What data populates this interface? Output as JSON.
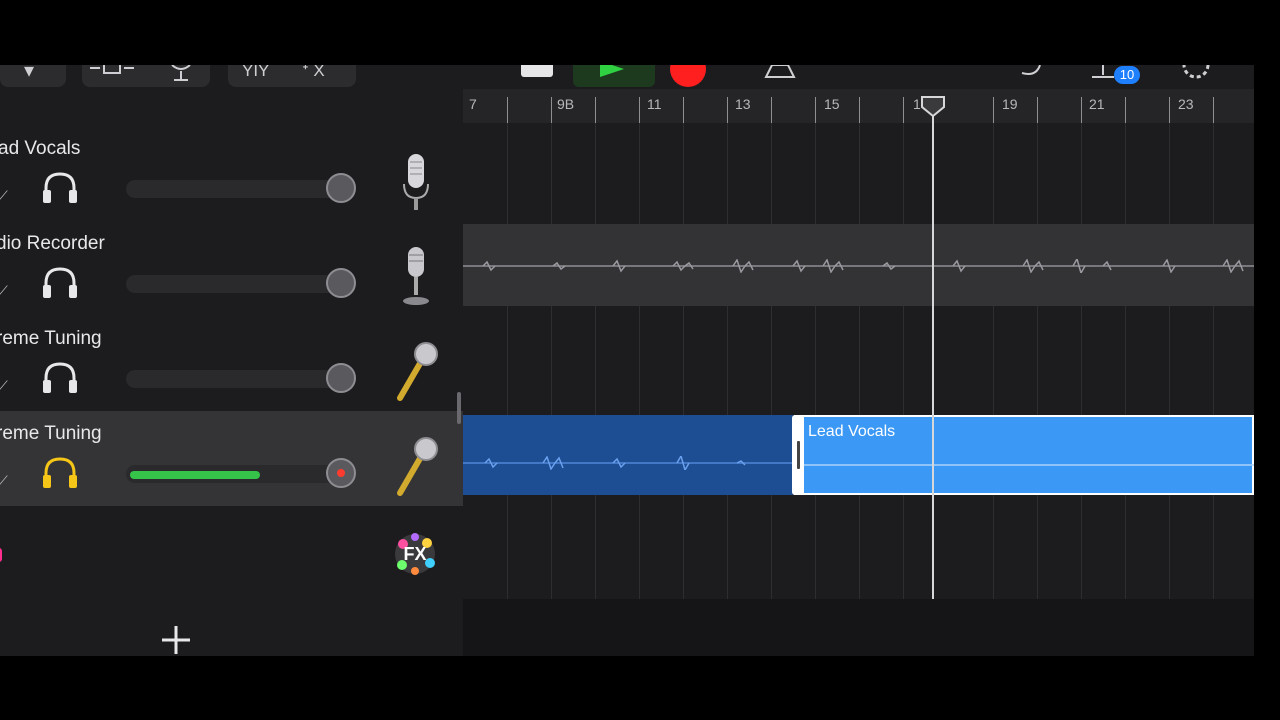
{
  "toolbar": {
    "notification_count": "10",
    "accent_record": "#ff1f1f",
    "accent_play": "#2fd142"
  },
  "ruler": {
    "labels": [
      "7",
      "9B",
      "11",
      "13",
      "15",
      "17",
      "19",
      "21",
      "23"
    ]
  },
  "tracks": [
    {
      "name": "ad Vocals",
      "instrument_icon": "condenser-mic-icon",
      "volume": null,
      "selected": false
    },
    {
      "name": "dio Recorder",
      "instrument_icon": "studio-mic-icon",
      "volume": null,
      "selected": false
    },
    {
      "name": "reme Tuning",
      "instrument_icon": "gold-mic-icon",
      "volume": null,
      "selected": false
    },
    {
      "name": "reme Tuning",
      "instrument_icon": "gold-mic-icon",
      "volume": 0.62,
      "selected": true,
      "record_armed": true
    }
  ],
  "fx_track": {
    "icon_label": "FX"
  },
  "regions": {
    "lead_vocals_label": "Lead Vocals"
  },
  "colors": {
    "region_blue": "#3b98f5",
    "region_dark_blue": "#1d4d93",
    "meter_green": "#35c34a",
    "headphone_active": "#f5c518"
  }
}
